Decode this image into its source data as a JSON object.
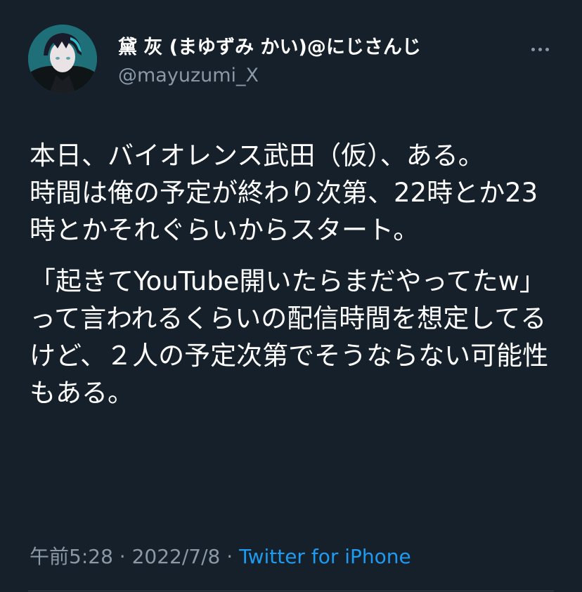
{
  "author": {
    "display_name": "黛 灰 (まゆずみ かい)@にじさんじ",
    "handle": "@mayuzumi_X",
    "avatar_icon": "avatar-icon"
  },
  "tweet": {
    "paragraphs": [
      "本日、バイオレンス武田（仮）、ある。\n時間は俺の予定が終わり次第、22時とか23時とかそれぐらいからスタート。",
      "「起きてYouTube開いたらまだやってたw」って言われるくらいの配信時間を想定してるけど、２人の予定次第でそうならない可能性もある。"
    ]
  },
  "meta": {
    "time": "午前5:28",
    "separator": "·",
    "date": "2022/7/8",
    "source": "Twitter for iPhone"
  },
  "more_menu_icon": "more-horizontal-icon",
  "colors": {
    "background": "#15202b",
    "primary_text": "#ffffff",
    "secondary_text": "#8b98a5",
    "link": "#1d9bf0",
    "divider": "#38444d"
  }
}
